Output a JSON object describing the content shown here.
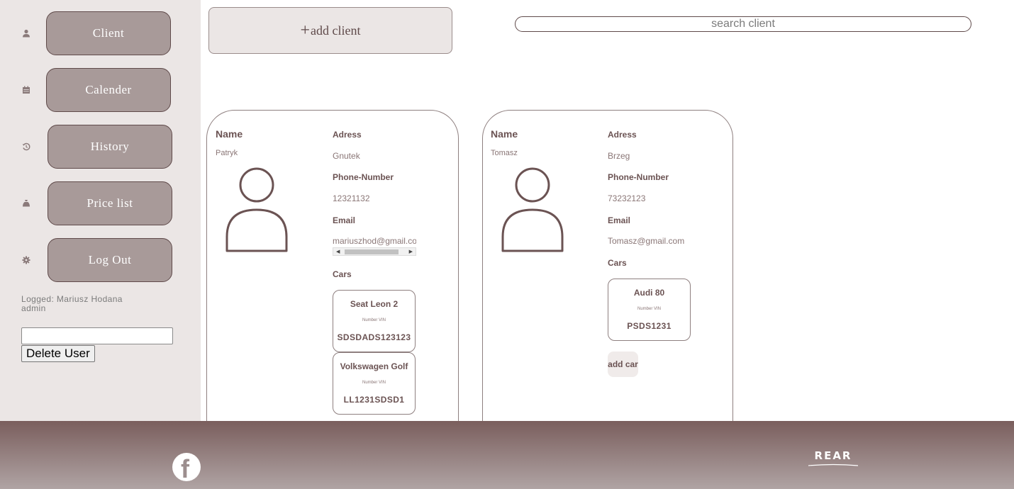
{
  "sidebar": {
    "items": [
      {
        "label": "Client",
        "icon": "user-icon"
      },
      {
        "label": "Calender",
        "icon": "calendar-icon"
      },
      {
        "label": "History",
        "icon": "history-icon"
      },
      {
        "label": "Price list",
        "icon": "money-bag-icon"
      },
      {
        "label": "Log Out",
        "icon": "gear-icon"
      }
    ],
    "logged_line1": "Logged: Mariusz Hodana",
    "logged_line2": "admin",
    "delete_input_value": "",
    "delete_button": "Delete User"
  },
  "top": {
    "add_client_plus": "+",
    "add_client_label": "add client",
    "search_placeholder": "search client"
  },
  "clients": [
    {
      "name_heading": "Name",
      "name": "Patryk",
      "adress_heading": "Adress",
      "adress": "Gnutek",
      "phone_heading": "Phone-Number",
      "phone": "12321132",
      "email_heading": "Email",
      "email": "mariuszhod@gmail.com",
      "cars_heading": "Cars",
      "cars": [
        {
          "model": "Seat Leon 2",
          "vin_label": "Number VIN",
          "vin": "SDSDADS123123"
        },
        {
          "model": "Volkswagen Golf",
          "vin_label": "Number VIN",
          "vin": "LL1231SDSD1"
        }
      ]
    },
    {
      "name_heading": "Name",
      "name": "Tomasz",
      "adress_heading": "Adress",
      "adress": "Brzeg",
      "phone_heading": "Phone-Number",
      "phone": "73232123",
      "email_heading": "Email",
      "email": "Tomasz@gmail.com",
      "cars_heading": "Cars",
      "cars": [
        {
          "model": "Audi 80",
          "vin_label": "Number VIN",
          "vin": "PSDS1231"
        }
      ],
      "add_car": "add car"
    }
  ],
  "footer": {
    "social_icon": "facebook-icon",
    "logo_text": "REAR"
  },
  "colors": {
    "sidebar_bg": "#ebe6e5",
    "nav_button": "#a89a99",
    "accent": "#6b5353",
    "footer_top": "#7a5e5d",
    "footer_bottom": "#b0a4a4"
  }
}
